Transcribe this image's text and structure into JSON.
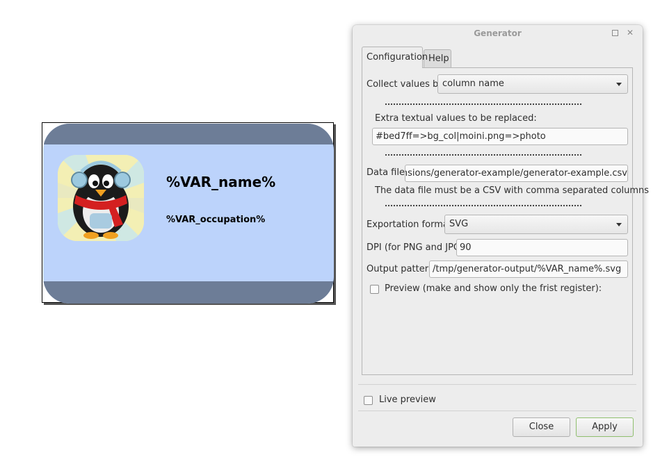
{
  "card": {
    "name_placeholder": "%VAR_name%",
    "occupation_placeholder": "%VAR_occupation%"
  },
  "dialog": {
    "title": "Generator",
    "tabs": [
      {
        "label": "Configuration",
        "active": true
      },
      {
        "label": "Help",
        "active": false
      }
    ],
    "collect": {
      "label": "Collect values by:",
      "value": "column name"
    },
    "extra": {
      "label": "Extra textual values to be replaced:",
      "value": "#bed7ff=>bg_col|moini.png=>photo"
    },
    "data_file": {
      "label": "Data file:",
      "value": "/usr/share/inkscape/extensions/generator-example/generator-example.csv",
      "hint": "The data file must be a CSV with comma separated columns"
    },
    "format": {
      "label": "Exportation format:",
      "value": "SVG"
    },
    "dpi": {
      "label": "DPI (for PNG and JPG):",
      "value": "90"
    },
    "output": {
      "label": "Output pattern:",
      "value": "/tmp/generator-output/%VAR_name%.svg"
    },
    "preview": {
      "label": "Preview (make and show only the frist register):",
      "checked": false
    },
    "live_preview": {
      "label": "Live preview",
      "checked": false
    },
    "buttons": {
      "close": "Close",
      "apply": "Apply"
    }
  },
  "colors": {
    "card_bg": "#bcd3fb",
    "card_band": "#6d7d97",
    "dialog_bg": "#ededed",
    "apply_border": "#8fbf6e"
  }
}
